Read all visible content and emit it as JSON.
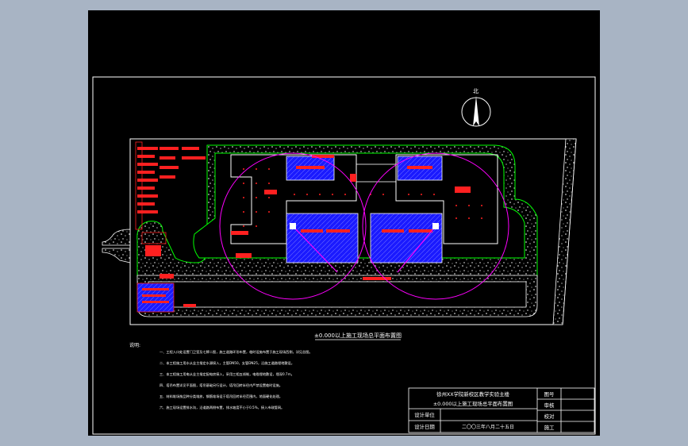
{
  "plan": {
    "north_label": "北",
    "title": "±0.000以上施工现场总平面布置图"
  },
  "notes": {
    "heading": "说明:",
    "lines": [
      "一、工程入口处设置门卫室及七牌二图，施工道路环形布置，临时设施布置于施工现场西侧，详见总图。",
      "二、本工程施工用水从业主指定水源接入，主管DN50，支管DN25，沿施工道路埋地敷设。",
      "三、本工程施工用电从业主指定配电房接入，采用三相五线制，电缆埋地敷设，埋深0.7m。",
      "四、塔吊布置详见平面图，塔吊基础另行设计，塔吊回转半径内严禁设置临时设施。",
      "五、材料堆场按品种分类堆放，钢筋堆场设于塔吊回转半径范围内，地面硬化处理。",
      "六、施工现场设置排水沟，沿道路两侧布置，排水坡度不小于0.5%，接入市政管网。"
    ]
  },
  "title_block": {
    "project_line1": "徐州XX学院新校区教学实验主楼",
    "project_line2": "±0.000以上施工现场总平面布置图",
    "unit_label": "设计单位",
    "date_label": "设计日期",
    "date_value": "二〇〇三年八月二十五日",
    "right_labels": [
      "图号",
      "审核",
      "校对",
      "施工"
    ]
  },
  "colors": {
    "background": "#000000",
    "building_fill": "#1a1aff",
    "boundary": "#ffffff",
    "site_outline": "#00ff00",
    "crane_radius": "#ff00ff",
    "labels": "#ff2020"
  }
}
